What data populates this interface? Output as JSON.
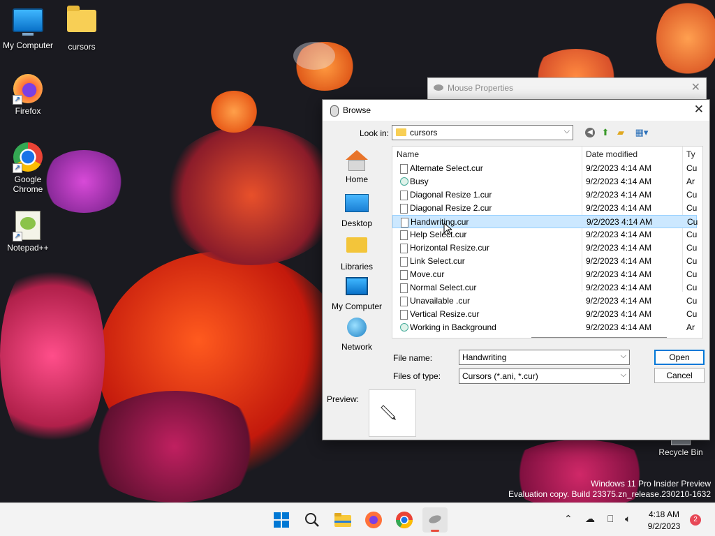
{
  "desktop": {
    "icons": [
      {
        "label": "My Computer",
        "icon": "monitor-icon"
      },
      {
        "label": "cursors",
        "icon": "folder-icon"
      },
      {
        "label": "Firefox",
        "icon": "firefox-icon"
      },
      {
        "label": "Google Chrome",
        "icon": "chrome-icon"
      },
      {
        "label": "Notepad++",
        "icon": "notepadpp-icon"
      },
      {
        "label": "Recycle Bin",
        "icon": "recycle-bin-icon"
      }
    ],
    "watermark_line1": "Windows 11 Pro Insider Preview",
    "watermark_line2": "Evaluation copy. Build 23375.zn_release.230210-1632"
  },
  "mouse_properties": {
    "title": "Mouse Properties",
    "close": "✕"
  },
  "dialog": {
    "title": "Browse",
    "close": "✕",
    "look_in_label": "Look in:",
    "look_in_value": "cursors",
    "places": [
      {
        "label": "Home"
      },
      {
        "label": "Desktop"
      },
      {
        "label": "Libraries"
      },
      {
        "label": "My Computer"
      },
      {
        "label": "Network"
      }
    ],
    "columns": {
      "name": "Name",
      "date": "Date modified",
      "type": "Ty"
    },
    "files": [
      {
        "name": "Alternate Select.cur",
        "date": "9/2/2023 4:14 AM",
        "type": "Cu",
        "kind": "cur"
      },
      {
        "name": "Busy",
        "date": "9/2/2023 4:14 AM",
        "type": "Ar",
        "kind": "ani"
      },
      {
        "name": "Diagonal Resize 1.cur",
        "date": "9/2/2023 4:14 AM",
        "type": "Cu",
        "kind": "cur"
      },
      {
        "name": "Diagonal Resize 2.cur",
        "date": "9/2/2023 4:14 AM",
        "type": "Cu",
        "kind": "cur"
      },
      {
        "name": "Handwriting.cur",
        "date": "9/2/2023 4:14 AM",
        "type": "Cu",
        "kind": "cur",
        "selected": true
      },
      {
        "name": "Help Select.cur",
        "date": "9/2/2023 4:14 AM",
        "type": "Cu",
        "kind": "cur"
      },
      {
        "name": "Horizontal Resize.cur",
        "date": "9/2/2023 4:14 AM",
        "type": "Cu",
        "kind": "cur"
      },
      {
        "name": "Link Select.cur",
        "date": "9/2/2023 4:14 AM",
        "type": "Cu",
        "kind": "cur"
      },
      {
        "name": "Move.cur",
        "date": "9/2/2023 4:14 AM",
        "type": "Cu",
        "kind": "cur"
      },
      {
        "name": "Normal Select.cur",
        "date": "9/2/2023 4:14 AM",
        "type": "Cu",
        "kind": "cur"
      },
      {
        "name": "Unavailable .cur",
        "date": "9/2/2023 4:14 AM",
        "type": "Cu",
        "kind": "cur"
      },
      {
        "name": "Vertical Resize.cur",
        "date": "9/2/2023 4:14 AM",
        "type": "Cu",
        "kind": "cur"
      },
      {
        "name": "Working in Background",
        "date": "9/2/2023 4:14 AM",
        "type": "Ar",
        "kind": "ani"
      }
    ],
    "file_name_label": "File name:",
    "file_name_value": "Handwriting",
    "file_type_label": "Files of type:",
    "file_type_value": "Cursors (*.ani, *.cur)",
    "open_label": "Open",
    "cancel_label": "Cancel",
    "preview_label": "Preview:"
  },
  "taskbar": {
    "apps": [
      "start-icon",
      "search-icon",
      "file-explorer-icon",
      "firefox-icon",
      "chrome-icon",
      "mouse-icon"
    ],
    "time": "4:18 AM",
    "date": "9/2/2023",
    "notification_count": "2"
  },
  "colors": {
    "accent": "#0078d7",
    "selection": "#cce8ff",
    "folder": "#f8cf55"
  }
}
